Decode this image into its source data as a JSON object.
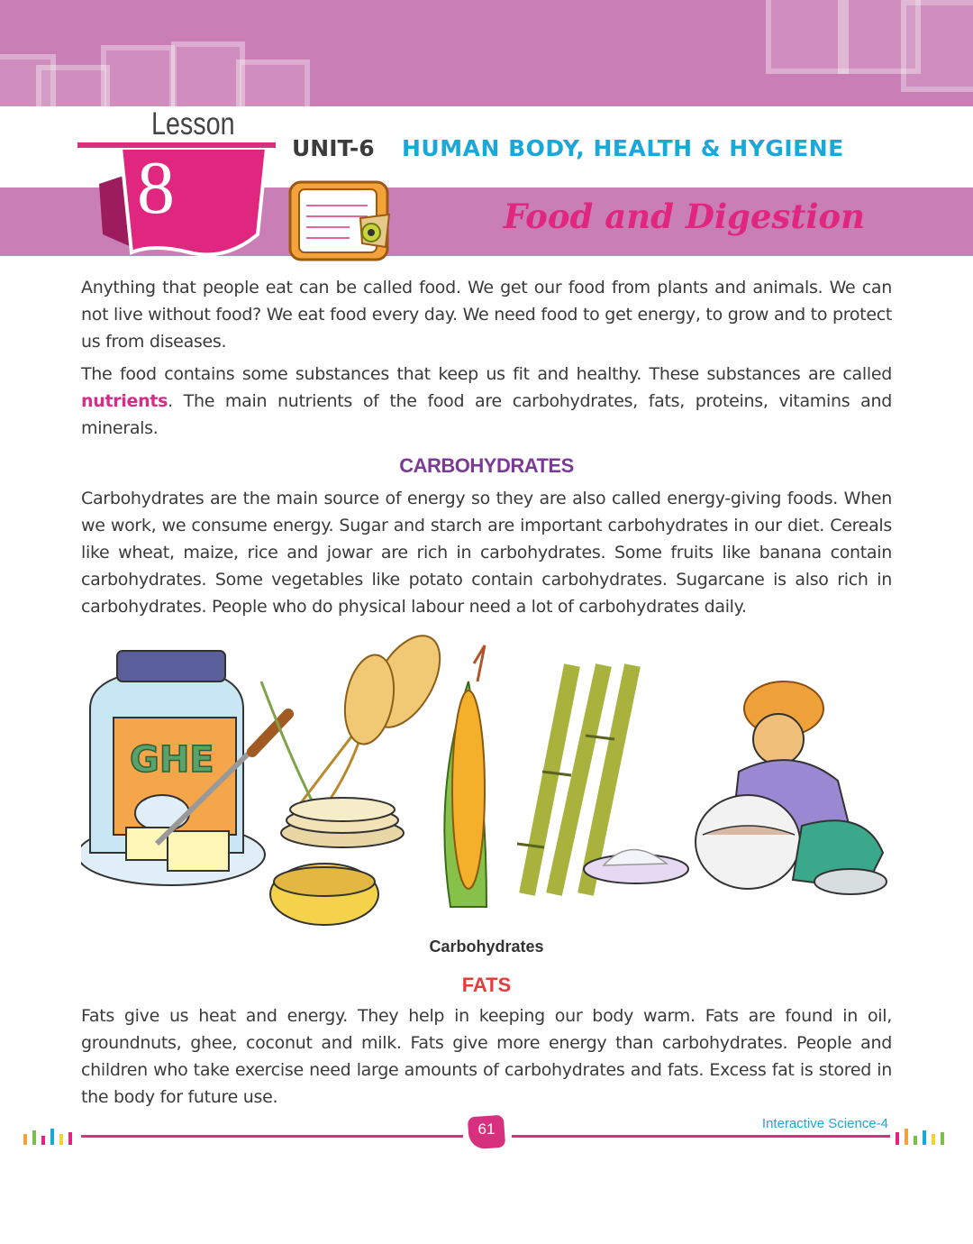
{
  "header": {
    "lesson_word": "Lesson",
    "lesson_number": "8",
    "unit_label": "UNIT-6",
    "unit_title": "HUMAN BODY, HEALTH & HYGIENE",
    "lesson_title": "Food and Digestion"
  },
  "intro": {
    "p1": "Anything that people eat can be called food. We get our food from plants and animals. We can not live without food? We eat food every day. We need food to get energy, to grow and to protect us from diseases.",
    "p2_before": "The food contains some substances that keep us fit and healthy. These substances are called ",
    "p2_highlight": "nutrients",
    "p2_after": ". The main nutrients of the food are carbohydrates, fats, proteins, vitamins and minerals."
  },
  "carbohydrates": {
    "heading": "CARBOHYDRATES",
    "text": "Carbohydrates are the main source of energy so they are also called energy-giving foods. When we work, we consume energy. Sugar and starch are important carbohydrates in our diet. Cereals like wheat, maize, rice and jowar are rich in carbohydrates. Some fruits like banana contain carbohydrates. Some vegetables like potato contain carbohydrates. Sugarcane is also rich in carbohydrates. People who do physical labour need a lot of carbohydrates daily.",
    "illustration_jar_label": "GHE",
    "caption": "Carbohydrates"
  },
  "fats": {
    "heading": "FATS",
    "text": "Fats give us heat and energy. They help in keeping our body warm. Fats are found in oil, groundnuts, ghee, coconut and milk. Fats give more energy than carbohydrates. People and children who take exercise need large amounts of carbohydrates and fats. Excess fat is stored in the body for future use."
  },
  "footer": {
    "page_number": "61",
    "series": "Interactive Science-4"
  },
  "colors": {
    "band": "#c97fb6",
    "accent_pink": "#d6307f",
    "title_pink": "#e0267f",
    "unit_blue": "#19a8d8",
    "carb_heading": "#7a3a96",
    "fats_heading": "#e43b3b"
  }
}
